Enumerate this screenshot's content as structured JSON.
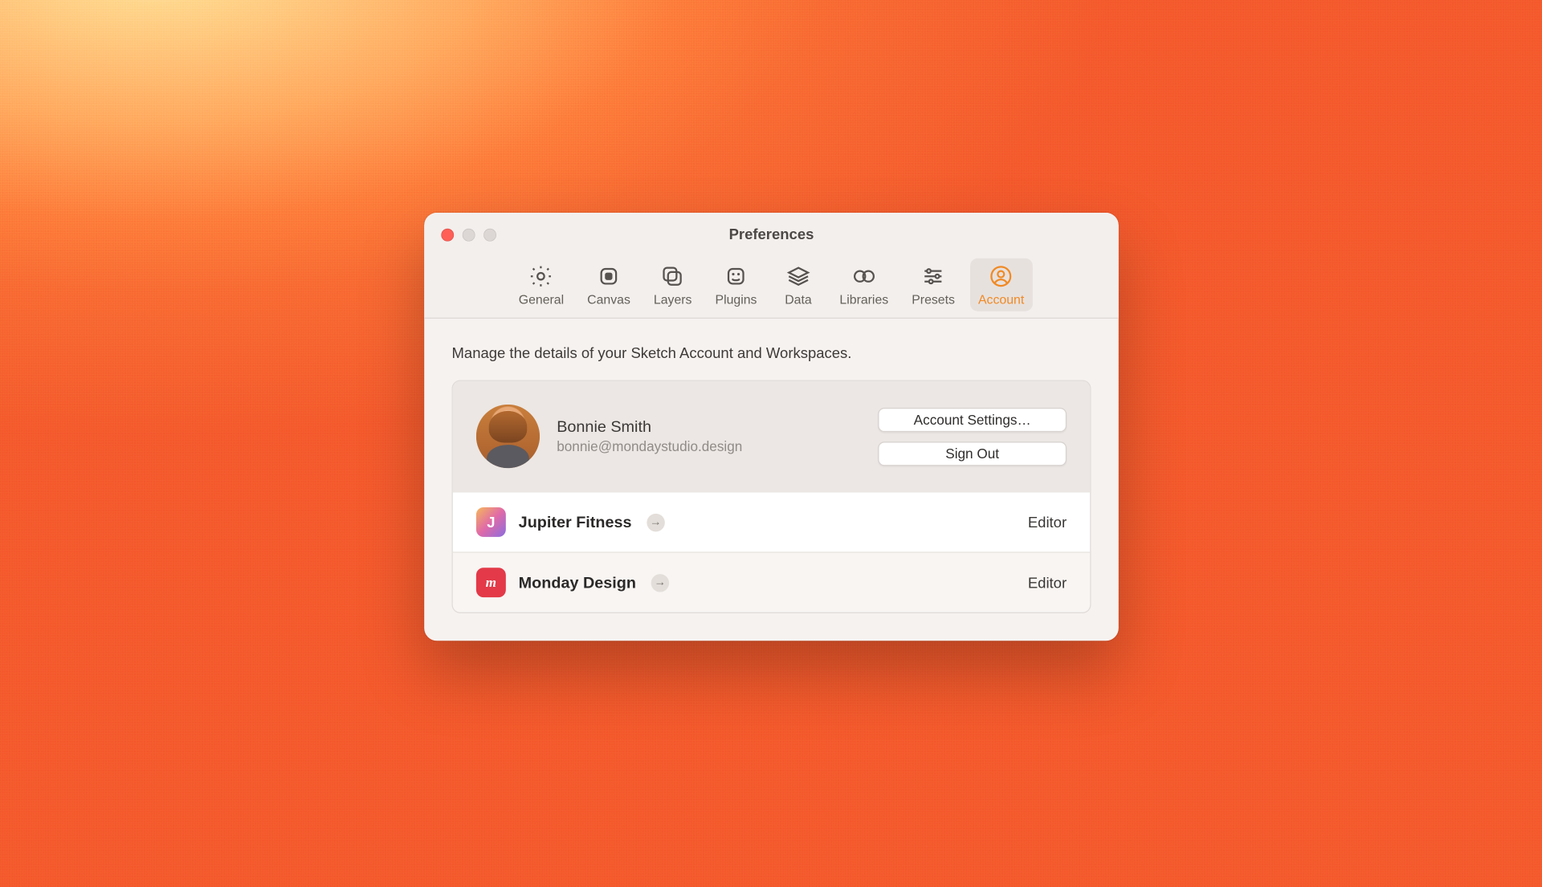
{
  "window": {
    "title": "Preferences"
  },
  "toolbar": {
    "items": [
      {
        "label": "General"
      },
      {
        "label": "Canvas"
      },
      {
        "label": "Layers"
      },
      {
        "label": "Plugins"
      },
      {
        "label": "Data"
      },
      {
        "label": "Libraries"
      },
      {
        "label": "Presets"
      },
      {
        "label": "Account"
      }
    ]
  },
  "content": {
    "description": "Manage the details of your Sketch Account and Workspaces."
  },
  "account": {
    "name": "Bonnie Smith",
    "email": "bonnie@mondaystudio.design",
    "settings_button": "Account Settings…",
    "signout_button": "Sign Out"
  },
  "workspaces": [
    {
      "name": "Jupiter Fitness",
      "role": "Editor",
      "icon_letter": "J"
    },
    {
      "name": "Monday Design",
      "role": "Editor",
      "icon_letter": "m"
    }
  ]
}
